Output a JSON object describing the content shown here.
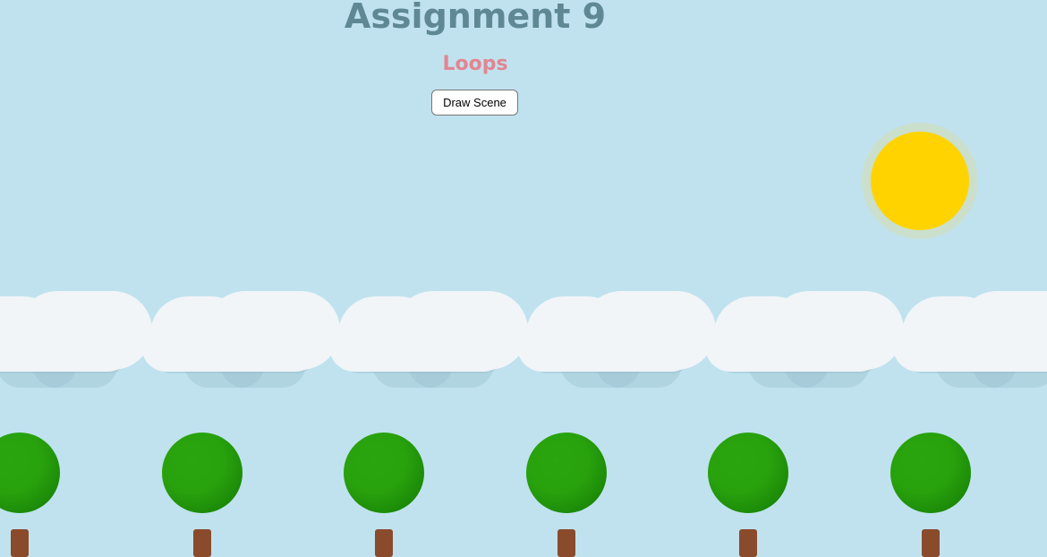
{
  "header": {
    "title": "Assignment 9",
    "subtitle": "Loops"
  },
  "controls": {
    "draw_button_label": "Draw Scene"
  },
  "scene": {
    "sky_color": "#c0e2ee",
    "sun_color": "#ffd300",
    "cloud_color": "#f1f5f8",
    "tree_crown_color": "#28a10d",
    "trunk_color": "#8a4a2c",
    "cloud_count": 6,
    "tree_count": 6
  }
}
